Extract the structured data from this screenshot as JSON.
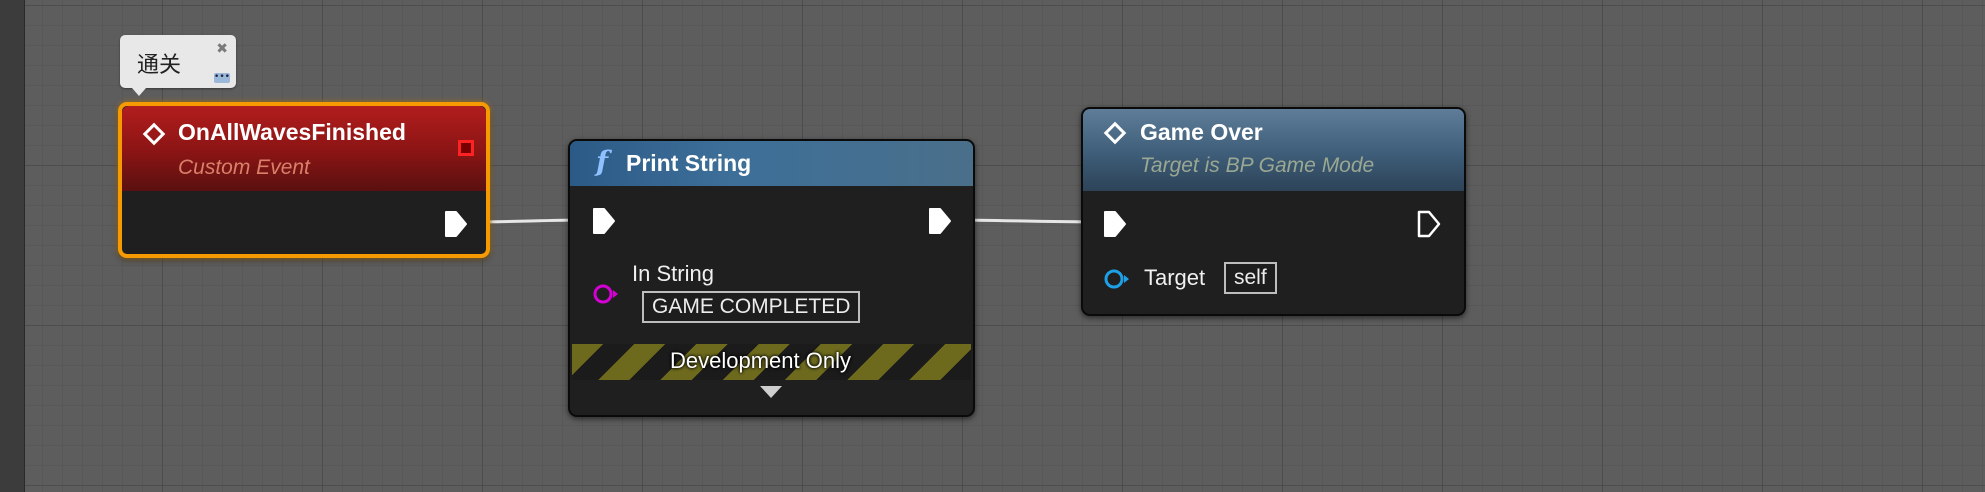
{
  "canvas": {
    "background_color": "#5d5d5d"
  },
  "comment": {
    "text": "通关"
  },
  "nodes": {
    "event": {
      "title": "OnAllWavesFinished",
      "subtitle": "Custom Event",
      "header_color": "#b21d1d",
      "selected_outline_color": "#f59a00",
      "icons": [
        "event-diamond-icon",
        "stop-icon",
        "exec-output-pin-icon"
      ]
    },
    "print": {
      "title": "Print String",
      "header_color": "#2c5a86",
      "in_string_label": "In String",
      "in_string_value": "GAME COMPLETED",
      "dev_label": "Development Only",
      "icons": [
        "function-icon",
        "exec-input-pin-icon",
        "exec-output-pin-icon",
        "string-pin-icon",
        "expand-arrow-icon"
      ]
    },
    "gameover": {
      "title": "Game Over",
      "subtitle": "Target is BP Game Mode",
      "header_color": "#40607c",
      "target_label": "Target",
      "target_value": "self",
      "icons": [
        "event-diamond-icon",
        "exec-input-pin-icon",
        "exec-output-pin-icon",
        "object-pin-icon"
      ]
    }
  },
  "colors": {
    "exec_wire": "#ffffff",
    "string_pin": "#d400d4",
    "object_pin": "#1ea0e6"
  }
}
